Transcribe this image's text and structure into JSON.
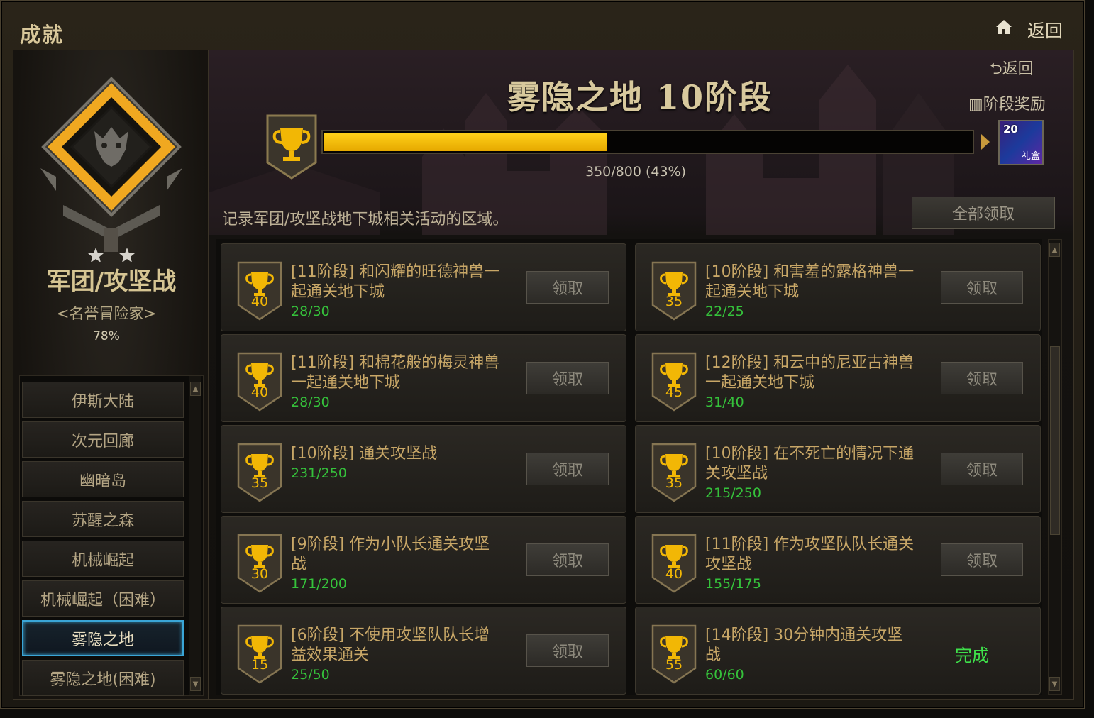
{
  "window": {
    "title": "成就",
    "back_label": "返回"
  },
  "category": {
    "title": "军团/攻坚战",
    "subtitle": "<名誉冒险家>",
    "percent": "78%"
  },
  "nav": {
    "items": [
      {
        "label": "伊斯大陆"
      },
      {
        "label": "次元回廊"
      },
      {
        "label": "幽暗岛"
      },
      {
        "label": "苏醒之森"
      },
      {
        "label": "机械崛起"
      },
      {
        "label": "机械崛起（困难）"
      },
      {
        "label": "雾隐之地",
        "selected": true
      },
      {
        "label": "雾隐之地(困难)"
      }
    ]
  },
  "stage": {
    "title": "雾隐之地 10阶段",
    "back_link": "返回",
    "reward_link": "阶段奖励",
    "progress_text": "350/800 (43%)",
    "progress_fraction": 0.4375,
    "reward_badge": "20",
    "reward_label": "礼盒"
  },
  "description": "记录军团/攻坚战地下城相关活动的区域。",
  "claim_all_label": "全部领取",
  "achievements": [
    {
      "points": "40",
      "task": "[11阶段] 和闪耀的旺德神兽一起通关地下城",
      "count": "28/30",
      "action": "领取"
    },
    {
      "points": "35",
      "task": "[10阶段] 和害羞的露格神兽一起通关地下城",
      "count": "22/25",
      "action": "领取"
    },
    {
      "points": "40",
      "task": "[11阶段] 和棉花般的梅灵神兽一起通关地下城",
      "count": "28/30",
      "action": "领取"
    },
    {
      "points": "45",
      "task": "[12阶段] 和云中的尼亚古神兽一起通关地下城",
      "count": "31/40",
      "action": "领取"
    },
    {
      "points": "35",
      "task": "[10阶段] 通关攻坚战",
      "count": "231/250",
      "action": "领取"
    },
    {
      "points": "35",
      "task": "[10阶段] 在不死亡的情况下通关攻坚战",
      "count": "215/250",
      "action": "领取"
    },
    {
      "points": "30",
      "task": "[9阶段] 作为小队长通关攻坚战",
      "count": "171/200",
      "action": "领取"
    },
    {
      "points": "40",
      "task": "[11阶段] 作为攻坚队队长通关攻坚战",
      "count": "155/175",
      "action": "领取"
    },
    {
      "points": "15",
      "task": "[6阶段] 不使用攻坚队队长增益效果通关",
      "count": "25/50",
      "action": "领取"
    },
    {
      "points": "55",
      "task": "[14阶段] 30分钟内通关攻坚战",
      "count": "60/60",
      "action": "完成"
    }
  ],
  "colors": {
    "accent_gold": "#f2b705",
    "count_green": "#35c23b",
    "done_green": "#3ee04a",
    "selected_border": "#3aa5d6"
  },
  "icons": [
    "home-icon",
    "trophy-icon",
    "back-arrow-icon",
    "gift-icon",
    "chevron-up-icon",
    "chevron-down-icon"
  ]
}
